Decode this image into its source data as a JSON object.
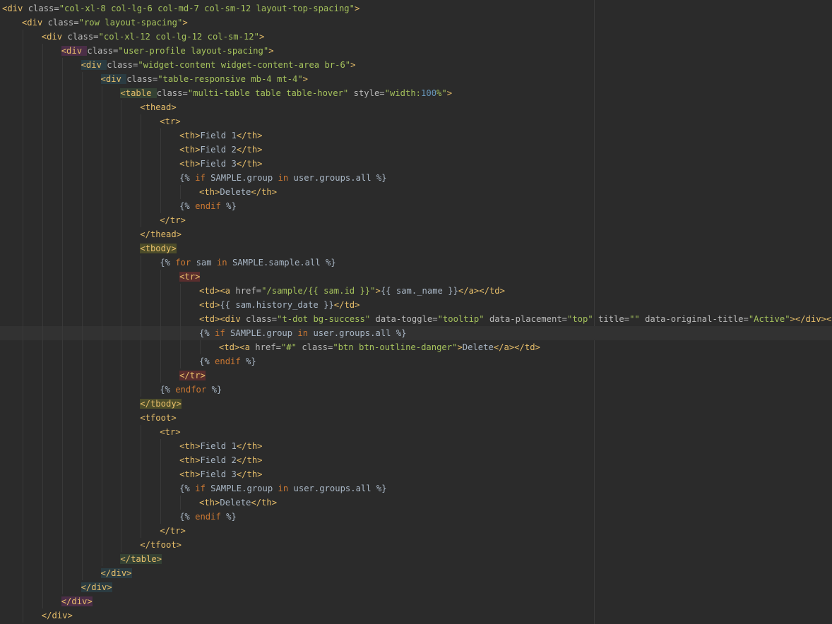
{
  "editor": {
    "lines": [
      {
        "indent": 0,
        "segments": [
          [
            "tk",
            "<div "
          ],
          [
            "at",
            "class="
          ],
          [
            "av",
            "\"col-xl-8 col-lg-6 col-md-7 col-sm-12 layout-top-spacing\""
          ],
          [
            "tk",
            ">"
          ]
        ]
      },
      {
        "indent": 1,
        "segments": [
          [
            "tk",
            "<div "
          ],
          [
            "at",
            "class="
          ],
          [
            "av",
            "\"row layout-spacing\""
          ],
          [
            "tk",
            ">"
          ]
        ]
      },
      {
        "indent": 2,
        "segments": [
          [
            "tk",
            "<div "
          ],
          [
            "at",
            "class="
          ],
          [
            "av",
            "\"col-xl-12 col-lg-12 col-sm-12\""
          ],
          [
            "tk",
            ">"
          ]
        ]
      },
      {
        "indent": 3,
        "hl": "pink",
        "segments": [
          [
            "tk",
            "<div "
          ],
          [
            "at",
            "class="
          ],
          [
            "av",
            "\"user-profile layout-spacing\""
          ],
          [
            "tk",
            ">"
          ]
        ]
      },
      {
        "indent": 4,
        "hl": "teal",
        "segments": [
          [
            "tk",
            "<div "
          ],
          [
            "at",
            "class="
          ],
          [
            "av",
            "\"widget-content widget-content-area br-6\""
          ],
          [
            "tk",
            ">"
          ]
        ]
      },
      {
        "indent": 5,
        "hl": "teal",
        "segments": [
          [
            "tk",
            "<div "
          ],
          [
            "at",
            "class="
          ],
          [
            "av",
            "\"table-responsive mb-4 mt-4\""
          ],
          [
            "tk",
            ">"
          ]
        ]
      },
      {
        "indent": 6,
        "hl": "green",
        "segments": [
          [
            "tk",
            "<table "
          ],
          [
            "at",
            "class="
          ],
          [
            "av",
            "\"multi-table table table-hover\" "
          ],
          [
            "at",
            "style="
          ],
          [
            "av",
            "\"width:"
          ],
          [
            "nm",
            "100"
          ],
          [
            "av",
            "%\""
          ],
          [
            "tk",
            ">"
          ]
        ]
      },
      {
        "indent": 7,
        "segments": [
          [
            "tk",
            "<thead>"
          ]
        ]
      },
      {
        "indent": 8,
        "segments": [
          [
            "tk",
            "<tr>"
          ]
        ]
      },
      {
        "indent": 9,
        "segments": [
          [
            "tk",
            "<th>"
          ],
          [
            "tx",
            "Field 1"
          ],
          [
            "tk",
            "</th>"
          ]
        ]
      },
      {
        "indent": 9,
        "segments": [
          [
            "tk",
            "<th>"
          ],
          [
            "tx",
            "Field 2"
          ],
          [
            "tk",
            "</th>"
          ]
        ]
      },
      {
        "indent": 9,
        "segments": [
          [
            "tk",
            "<th>"
          ],
          [
            "tx",
            "Field 3"
          ],
          [
            "tk",
            "</th>"
          ]
        ]
      },
      {
        "indent": 9,
        "segments": [
          [
            "tx",
            "{% "
          ],
          [
            "kw",
            "if "
          ],
          [
            "tx",
            "SAMPLE.group "
          ],
          [
            "kw",
            "in "
          ],
          [
            "tx",
            "user.groups.all %}"
          ]
        ]
      },
      {
        "indent": 10,
        "segments": [
          [
            "tk",
            "<th>"
          ],
          [
            "tx",
            "Delete"
          ],
          [
            "tk",
            "</th>"
          ]
        ]
      },
      {
        "indent": 9,
        "segments": [
          [
            "tx",
            "{% "
          ],
          [
            "kw",
            "endif "
          ],
          [
            "tx",
            "%}"
          ]
        ]
      },
      {
        "indent": 8,
        "segments": [
          [
            "tk",
            "</tr>"
          ]
        ]
      },
      {
        "indent": 7,
        "segments": [
          [
            "tk",
            "</thead>"
          ]
        ]
      },
      {
        "indent": 7,
        "hl": "olive",
        "segments": [
          [
            "tk",
            "<tbody>"
          ]
        ]
      },
      {
        "indent": 8,
        "segments": [
          [
            "tx",
            "{% "
          ],
          [
            "kw",
            "for "
          ],
          [
            "tx",
            "sam "
          ],
          [
            "kw",
            "in "
          ],
          [
            "tx",
            "SAMPLE.sample.all %}"
          ]
        ]
      },
      {
        "indent": 9,
        "hl": "red",
        "segments": [
          [
            "tk",
            "<tr>"
          ]
        ]
      },
      {
        "indent": 10,
        "segments": [
          [
            "tk",
            "<td><a "
          ],
          [
            "at",
            "href="
          ],
          [
            "av",
            "\"/sample/{{ sam.id }}\""
          ],
          [
            "tk",
            ">"
          ],
          [
            "tx",
            "{{ sam._name }}"
          ],
          [
            "tk",
            "</a></td>"
          ]
        ]
      },
      {
        "indent": 10,
        "segments": [
          [
            "tk",
            "<td>"
          ],
          [
            "tx",
            "{{ sam.history_date }}"
          ],
          [
            "tk",
            "</td>"
          ]
        ]
      },
      {
        "indent": 10,
        "segments": [
          [
            "tk",
            "<td><div "
          ],
          [
            "at",
            "class="
          ],
          [
            "av",
            "\"t-dot bg-success\" "
          ],
          [
            "at",
            "data-toggle="
          ],
          [
            "av",
            "\"tooltip\" "
          ],
          [
            "at",
            "data-placement="
          ],
          [
            "av",
            "\"top\" "
          ],
          [
            "at",
            "title="
          ],
          [
            "av",
            "\"\" "
          ],
          [
            "at",
            "data-original-title="
          ],
          [
            "av",
            "\"Active\""
          ],
          [
            "tk",
            "></div></td>"
          ]
        ]
      },
      {
        "indent": 10,
        "current": true,
        "segments": [
          [
            "tx",
            "{% "
          ],
          [
            "kw",
            "if "
          ],
          [
            "tx",
            "SAMPLE.group "
          ],
          [
            "kw",
            "in "
          ],
          [
            "tx",
            "user.groups.all %}"
          ]
        ]
      },
      {
        "indent": 11,
        "segments": [
          [
            "tk",
            "<td><a "
          ],
          [
            "at",
            "href="
          ],
          [
            "av",
            "\"#\" "
          ],
          [
            "at",
            "class="
          ],
          [
            "av",
            "\"btn btn-outline-danger\""
          ],
          [
            "tk",
            ">"
          ],
          [
            "tx",
            "Delete"
          ],
          [
            "tk",
            "</a></td>"
          ]
        ]
      },
      {
        "indent": 10,
        "segments": [
          [
            "tx",
            "{% "
          ],
          [
            "kw",
            "endif "
          ],
          [
            "tx",
            "%}"
          ]
        ]
      },
      {
        "indent": 9,
        "hl": "red",
        "segments": [
          [
            "tk",
            "</tr>"
          ]
        ]
      },
      {
        "indent": 8,
        "segments": [
          [
            "tx",
            "{% "
          ],
          [
            "kw",
            "endfor "
          ],
          [
            "tx",
            "%}"
          ]
        ]
      },
      {
        "indent": 7,
        "hl": "olive",
        "segments": [
          [
            "tk",
            "</tbody>"
          ]
        ]
      },
      {
        "indent": 7,
        "segments": [
          [
            "tk",
            "<tfoot>"
          ]
        ]
      },
      {
        "indent": 8,
        "segments": [
          [
            "tk",
            "<tr>"
          ]
        ]
      },
      {
        "indent": 9,
        "segments": [
          [
            "tk",
            "<th>"
          ],
          [
            "tx",
            "Field 1"
          ],
          [
            "tk",
            "</th>"
          ]
        ]
      },
      {
        "indent": 9,
        "segments": [
          [
            "tk",
            "<th>"
          ],
          [
            "tx",
            "Field 2"
          ],
          [
            "tk",
            "</th>"
          ]
        ]
      },
      {
        "indent": 9,
        "segments": [
          [
            "tk",
            "<th>"
          ],
          [
            "tx",
            "Field 3"
          ],
          [
            "tk",
            "</th>"
          ]
        ]
      },
      {
        "indent": 9,
        "segments": [
          [
            "tx",
            "{% "
          ],
          [
            "kw",
            "if "
          ],
          [
            "tx",
            "SAMPLE.group "
          ],
          [
            "kw",
            "in "
          ],
          [
            "tx",
            "user.groups.all %}"
          ]
        ]
      },
      {
        "indent": 10,
        "segments": [
          [
            "tk",
            "<th>"
          ],
          [
            "tx",
            "Delete"
          ],
          [
            "tk",
            "</th>"
          ]
        ]
      },
      {
        "indent": 9,
        "segments": [
          [
            "tx",
            "{% "
          ],
          [
            "kw",
            "endif "
          ],
          [
            "tx",
            "%}"
          ]
        ]
      },
      {
        "indent": 8,
        "segments": [
          [
            "tk",
            "</tr>"
          ]
        ]
      },
      {
        "indent": 7,
        "segments": [
          [
            "tk",
            "</tfoot>"
          ]
        ]
      },
      {
        "indent": 6,
        "hl": "green",
        "segments": [
          [
            "tk",
            "</table>"
          ]
        ]
      },
      {
        "indent": 5,
        "hl": "teal",
        "segments": [
          [
            "tk",
            "</div>"
          ]
        ]
      },
      {
        "indent": 4,
        "hl": "teal",
        "segments": [
          [
            "tk",
            "</div>"
          ]
        ]
      },
      {
        "indent": 3,
        "hl": "pink",
        "segments": [
          [
            "tk",
            "</div>"
          ]
        ]
      },
      {
        "indent": 2,
        "segments": [
          [
            "tk",
            "</div>"
          ]
        ]
      }
    ]
  }
}
